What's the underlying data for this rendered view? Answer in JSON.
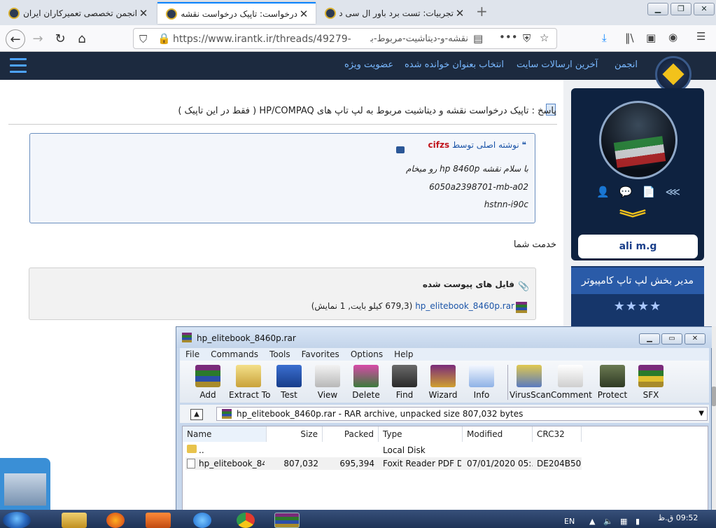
{
  "browser": {
    "tabs": [
      {
        "title": "تجربیات: تست برد باور ال سی دی"
      },
      {
        "title": "درخواست: تاپیک درخواست نقشه و دیتاشیت"
      },
      {
        "title": "انجمن تخصصی تعمیرکاران ایران | تع"
      }
    ],
    "url": "https://www.irantk.ir/threads/49279-",
    "url_rtl": "نقشه-و-دیتاشیت-مربوط-به-لپ-تاپ-های-"
  },
  "site": {
    "menu": [
      {
        "label": "انجمن"
      },
      {
        "label": "آخرین ارسالات سایت"
      },
      {
        "label": "انتخاب بعنوان خوانده شده"
      },
      {
        "label": "عضویت ویژه"
      }
    ]
  },
  "post": {
    "title": "پاسخ : تاپیک درخواست نقشه و دیتاشیت مربوط به لپ تاپ های HP/COMPAQ ( فقط در این تاپیک )",
    "quote": {
      "prefix": "نوشته اصلی توسط",
      "author": "cifzs",
      "lines": [
        "با سلام نقشه hp 8460p رو میخام",
        "6050a2398701-mb-a02",
        "hstnn-i90c"
      ]
    },
    "reply": "خدمت شما",
    "attachments": {
      "title": "فایل های پیوست شده",
      "file_name": "hp_elitebook_8460p.rar",
      "file_meta": "(679,3 کیلو بایت, 1 نمایش)"
    }
  },
  "profile": {
    "username": "ali m.g",
    "role": "مدیر بخش لپ تاپ کامپیوتر",
    "stars": "★★★★"
  },
  "winrar": {
    "title": "hp_elitebook_8460p.rar",
    "menu": [
      "File",
      "Commands",
      "Tools",
      "Favorites",
      "Options",
      "Help"
    ],
    "tools": [
      "Add",
      "Extract To",
      "Test",
      "View",
      "Delete",
      "Find",
      "Wizard",
      "Info",
      "VirusScan",
      "Comment",
      "Protect",
      "SFX"
    ],
    "path": "hp_elitebook_8460p.rar - RAR archive, unpacked size 807,032 bytes",
    "columns": [
      "Name",
      "Size",
      "Packed",
      "Type",
      "Modified",
      "CRC32"
    ],
    "rows": [
      {
        "name": "..",
        "size": "",
        "packed": "",
        "type": "Local Disk",
        "modified": "",
        "crc": ""
      },
      {
        "name": "hp_elitebook_84...",
        "size": "807,032",
        "packed": "695,394",
        "type": "Foxit Reader PDF D...",
        "modified": "07/01/2020 05:...",
        "crc": "DE204B50"
      }
    ]
  },
  "taskbar": {
    "lang": "EN",
    "time": "09:52 ق.ظ"
  }
}
